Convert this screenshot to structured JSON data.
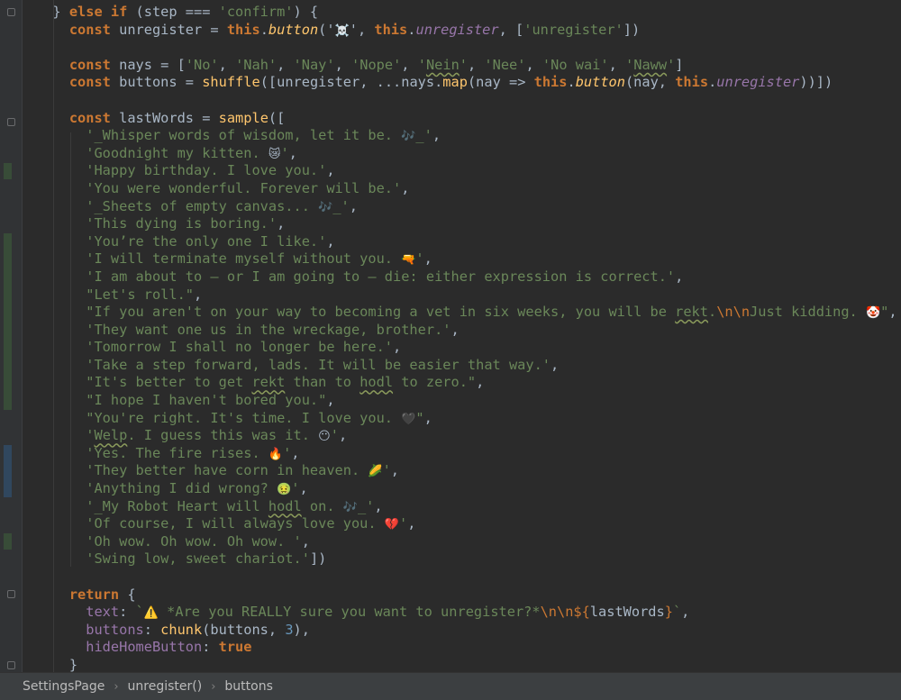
{
  "editor": {
    "lines": [
      [
        {
          "t": "  } ",
          "c": ""
        },
        {
          "t": "else if",
          "c": "kw"
        },
        {
          "t": " (step === ",
          "c": ""
        },
        {
          "t": "'confirm'",
          "c": "str"
        },
        {
          "t": ") {",
          "c": ""
        }
      ],
      [
        {
          "t": "    ",
          "c": ""
        },
        {
          "t": "const",
          "c": "kw"
        },
        {
          "t": " unregister = ",
          "c": ""
        },
        {
          "t": "this",
          "c": "this"
        },
        {
          "t": ".",
          "c": ""
        },
        {
          "t": "button",
          "c": "mthd"
        },
        {
          "t": "('",
          "c": ""
        },
        {
          "t": "☠️",
          "c": "emoji"
        },
        {
          "t": "', ",
          "c": ""
        },
        {
          "t": "this",
          "c": "this"
        },
        {
          "t": ".",
          "c": ""
        },
        {
          "t": "unregister",
          "c": "prop-i"
        },
        {
          "t": ", [",
          "c": ""
        },
        {
          "t": "'unregister'",
          "c": "str"
        },
        {
          "t": "])",
          "c": ""
        }
      ],
      [],
      [
        {
          "t": "    ",
          "c": ""
        },
        {
          "t": "const",
          "c": "kw"
        },
        {
          "t": " nays = [",
          "c": ""
        },
        {
          "t": "'No'",
          "c": "str"
        },
        {
          "t": ", ",
          "c": ""
        },
        {
          "t": "'Nah'",
          "c": "str"
        },
        {
          "t": ", ",
          "c": ""
        },
        {
          "t": "'Nay'",
          "c": "str"
        },
        {
          "t": ", ",
          "c": ""
        },
        {
          "t": "'Nope'",
          "c": "str"
        },
        {
          "t": ", ",
          "c": ""
        },
        {
          "t": "'",
          "c": "str"
        },
        {
          "t": "Nein",
          "c": "str typo"
        },
        {
          "t": "'",
          "c": "str"
        },
        {
          "t": ", ",
          "c": ""
        },
        {
          "t": "'Nee'",
          "c": "str"
        },
        {
          "t": ", ",
          "c": ""
        },
        {
          "t": "'No wai'",
          "c": "str"
        },
        {
          "t": ", ",
          "c": ""
        },
        {
          "t": "'",
          "c": "str"
        },
        {
          "t": "Naww",
          "c": "str typo"
        },
        {
          "t": "'",
          "c": "str"
        },
        {
          "t": "]",
          "c": ""
        }
      ],
      [
        {
          "t": "    ",
          "c": ""
        },
        {
          "t": "const",
          "c": "kw"
        },
        {
          "t": " buttons = ",
          "c": ""
        },
        {
          "t": "shuffle",
          "c": "fn"
        },
        {
          "t": "([unregister, ...nays.",
          "c": ""
        },
        {
          "t": "map",
          "c": "fn"
        },
        {
          "t": "(nay => ",
          "c": ""
        },
        {
          "t": "this",
          "c": "this"
        },
        {
          "t": ".",
          "c": ""
        },
        {
          "t": "button",
          "c": "mthd"
        },
        {
          "t": "(nay, ",
          "c": ""
        },
        {
          "t": "this",
          "c": "this"
        },
        {
          "t": ".",
          "c": ""
        },
        {
          "t": "unregister",
          "c": "prop-i"
        },
        {
          "t": "))])",
          "c": ""
        }
      ],
      [],
      [
        {
          "t": "    ",
          "c": ""
        },
        {
          "t": "const",
          "c": "kw"
        },
        {
          "t": " lastWords = ",
          "c": ""
        },
        {
          "t": "sample",
          "c": "fn"
        },
        {
          "t": "([",
          "c": ""
        }
      ],
      [
        {
          "t": "      ",
          "c": ""
        },
        {
          "t": "'_Whisper words of wisdom, let it be. ",
          "c": "str"
        },
        {
          "t": "🎶",
          "c": "emoji"
        },
        {
          "t": "_'",
          "c": "str"
        },
        {
          "t": ",",
          "c": ""
        }
      ],
      [
        {
          "t": "      ",
          "c": ""
        },
        {
          "t": "'Goodnight my kitten. ",
          "c": "str"
        },
        {
          "t": "😿",
          "c": "emoji"
        },
        {
          "t": "'",
          "c": "str"
        },
        {
          "t": ",",
          "c": ""
        }
      ],
      [
        {
          "t": "      ",
          "c": ""
        },
        {
          "t": "'Happy birthday. I love you.'",
          "c": "str"
        },
        {
          "t": ",",
          "c": ""
        }
      ],
      [
        {
          "t": "      ",
          "c": ""
        },
        {
          "t": "'You were wonderful. Forever will be.'",
          "c": "str"
        },
        {
          "t": ",",
          "c": ""
        }
      ],
      [
        {
          "t": "      ",
          "c": ""
        },
        {
          "t": "'_Sheets of empty canvas... ",
          "c": "str"
        },
        {
          "t": "🎶",
          "c": "emoji"
        },
        {
          "t": "_'",
          "c": "str"
        },
        {
          "t": ",",
          "c": ""
        }
      ],
      [
        {
          "t": "      ",
          "c": ""
        },
        {
          "t": "'This dying is boring.'",
          "c": "str"
        },
        {
          "t": ",",
          "c": ""
        }
      ],
      [
        {
          "t": "      ",
          "c": ""
        },
        {
          "t": "'You’re the only one I like.'",
          "c": "str"
        },
        {
          "t": ",",
          "c": ""
        }
      ],
      [
        {
          "t": "      ",
          "c": ""
        },
        {
          "t": "'I will terminate myself without you. ",
          "c": "str"
        },
        {
          "t": "🔫",
          "c": "emoji pistol"
        },
        {
          "t": "'",
          "c": "str"
        },
        {
          "t": ",",
          "c": ""
        }
      ],
      [
        {
          "t": "      ",
          "c": ""
        },
        {
          "t": "'I am about to – or I am going to – die: either expression is correct.'",
          "c": "str"
        },
        {
          "t": ",",
          "c": ""
        }
      ],
      [
        {
          "t": "      ",
          "c": ""
        },
        {
          "t": "\"Let's roll.\"",
          "c": "str"
        },
        {
          "t": ",",
          "c": ""
        }
      ],
      [
        {
          "t": "      ",
          "c": ""
        },
        {
          "t": "\"If you aren't on your way to becoming a vet in six weeks, you will be ",
          "c": "str"
        },
        {
          "t": "rekt",
          "c": "str typo"
        },
        {
          "t": ".",
          "c": "str"
        },
        {
          "t": "\\n\\n",
          "c": "esc"
        },
        {
          "t": "Just kidding. ",
          "c": "str"
        },
        {
          "t": "🤡",
          "c": "emoji"
        },
        {
          "t": "\"",
          "c": "str"
        },
        {
          "t": ",",
          "c": ""
        }
      ],
      [
        {
          "t": "      ",
          "c": ""
        },
        {
          "t": "'They want one us in the wreckage, brother.'",
          "c": "str"
        },
        {
          "t": ",",
          "c": ""
        }
      ],
      [
        {
          "t": "      ",
          "c": ""
        },
        {
          "t": "'Tomorrow I shall no longer be here.'",
          "c": "str"
        },
        {
          "t": ",",
          "c": ""
        }
      ],
      [
        {
          "t": "      ",
          "c": ""
        },
        {
          "t": "'Take a step forward, lads. It will be easier that way.'",
          "c": "str"
        },
        {
          "t": ",",
          "c": ""
        }
      ],
      [
        {
          "t": "      ",
          "c": ""
        },
        {
          "t": "\"It's better to get ",
          "c": "str"
        },
        {
          "t": "rekt",
          "c": "str typo"
        },
        {
          "t": " than to ",
          "c": "str"
        },
        {
          "t": "hodl",
          "c": "str typo"
        },
        {
          "t": " to zero.\"",
          "c": "str"
        },
        {
          "t": ",",
          "c": ""
        }
      ],
      [
        {
          "t": "      ",
          "c": ""
        },
        {
          "t": "\"I hope I haven't bored you.\"",
          "c": "str"
        },
        {
          "t": ",",
          "c": ""
        }
      ],
      [
        {
          "t": "      ",
          "c": ""
        },
        {
          "t": "\"You're right. It's time. I love you. ",
          "c": "str"
        },
        {
          "t": "🖤",
          "c": "emoji"
        },
        {
          "t": "\"",
          "c": "str"
        },
        {
          "t": ",",
          "c": ""
        }
      ],
      [
        {
          "t": "      ",
          "c": ""
        },
        {
          "t": "'",
          "c": "str"
        },
        {
          "t": "Welp",
          "c": "str typo"
        },
        {
          "t": ". I guess this was it. ",
          "c": "str"
        },
        {
          "t": "😶",
          "c": "emoji"
        },
        {
          "t": "'",
          "c": "str"
        },
        {
          "t": ",",
          "c": ""
        }
      ],
      [
        {
          "t": "      ",
          "c": ""
        },
        {
          "t": "'Yes. The fire rises. ",
          "c": "str"
        },
        {
          "t": "🔥",
          "c": "emoji fire"
        },
        {
          "t": "'",
          "c": "str"
        },
        {
          "t": ",",
          "c": ""
        }
      ],
      [
        {
          "t": "      ",
          "c": ""
        },
        {
          "t": "'They better have corn in heaven. ",
          "c": "str"
        },
        {
          "t": "🌽",
          "c": "emoji corn"
        },
        {
          "t": "'",
          "c": "str"
        },
        {
          "t": ",",
          "c": ""
        }
      ],
      [
        {
          "t": "      ",
          "c": ""
        },
        {
          "t": "'Anything I did wrong? ",
          "c": "str"
        },
        {
          "t": "🤢",
          "c": "emoji"
        },
        {
          "t": "'",
          "c": "str"
        },
        {
          "t": ",",
          "c": ""
        }
      ],
      [
        {
          "t": "      ",
          "c": ""
        },
        {
          "t": "'_My Robot Heart will ",
          "c": "str"
        },
        {
          "t": "hodl",
          "c": "str typo"
        },
        {
          "t": " on. ",
          "c": "str"
        },
        {
          "t": "🎶",
          "c": "emoji"
        },
        {
          "t": "_'",
          "c": "str"
        },
        {
          "t": ",",
          "c": ""
        }
      ],
      [
        {
          "t": "      ",
          "c": ""
        },
        {
          "t": "'Of course, I will always love you. ",
          "c": "str"
        },
        {
          "t": "💔",
          "c": "emoji heart"
        },
        {
          "t": "'",
          "c": "str"
        },
        {
          "t": ",",
          "c": ""
        }
      ],
      [
        {
          "t": "      ",
          "c": ""
        },
        {
          "t": "'Oh wow. Oh wow. Oh wow. ",
          "c": "str"
        },
        {
          "t": "",
          "c": "emoji"
        },
        {
          "t": "'",
          "c": "str"
        },
        {
          "t": ",",
          "c": ""
        }
      ],
      [
        {
          "t": "      ",
          "c": ""
        },
        {
          "t": "'Swing low, sweet chariot.'",
          "c": "str"
        },
        {
          "t": "])",
          "c": ""
        }
      ],
      [],
      [
        {
          "t": "    ",
          "c": ""
        },
        {
          "t": "return",
          "c": "kw"
        },
        {
          "t": " {",
          "c": ""
        }
      ],
      [
        {
          "t": "      ",
          "c": ""
        },
        {
          "t": "text",
          "c": "prop"
        },
        {
          "t": ": ",
          "c": ""
        },
        {
          "t": "`",
          "c": "str"
        },
        {
          "t": "⚠️",
          "c": "emoji warn"
        },
        {
          "t": " *Are you REALLY sure you want to unregister?*",
          "c": "str"
        },
        {
          "t": "\\n\\n",
          "c": "esc"
        },
        {
          "t": "${",
          "c": "esc"
        },
        {
          "t": "lastWords",
          "c": ""
        },
        {
          "t": "}",
          "c": "esc"
        },
        {
          "t": "`",
          "c": "str"
        },
        {
          "t": ",",
          "c": ""
        }
      ],
      [
        {
          "t": "      ",
          "c": ""
        },
        {
          "t": "buttons",
          "c": "prop"
        },
        {
          "t": ": ",
          "c": ""
        },
        {
          "t": "chunk",
          "c": "fn"
        },
        {
          "t": "(buttons, ",
          "c": ""
        },
        {
          "t": "3",
          "c": "num"
        },
        {
          "t": "),",
          "c": ""
        }
      ],
      [
        {
          "t": "      ",
          "c": ""
        },
        {
          "t": "hideHomeButton",
          "c": "prop"
        },
        {
          "t": ": ",
          "c": ""
        },
        {
          "t": "true",
          "c": "kw"
        }
      ],
      [
        {
          "t": "    }",
          "c": ""
        }
      ]
    ]
  },
  "breadcrumbs": [
    "SettingsPage",
    "unregister()",
    "buttons"
  ],
  "breadcrumb_separator": "›",
  "colors": {
    "background": "#2b2b2b",
    "keyword": "#cc7832",
    "string": "#6a8759",
    "function": "#ffc66d",
    "property": "#9876aa",
    "number": "#6897bb",
    "text": "#a9b7c6"
  }
}
